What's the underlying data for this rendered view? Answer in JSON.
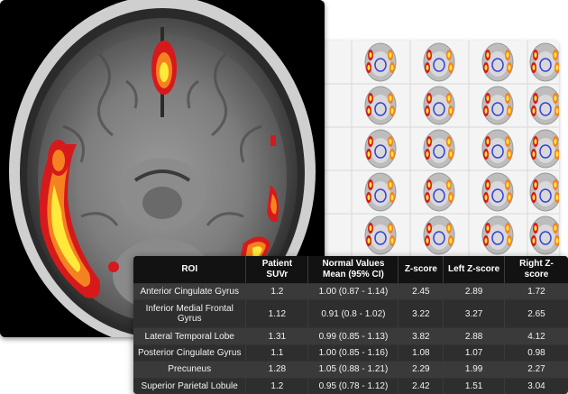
{
  "table": {
    "headers": {
      "roi": "ROI",
      "patient_suvr": "Patient SUVr",
      "normal_values_line1": "Normal Values",
      "normal_values_line2": "Mean (95% CI)",
      "z_score": "Z-score",
      "left_z_score": "Left Z-score",
      "right_z_score": "Right Z-score"
    },
    "rows": [
      {
        "roi": "Anterior Cingulate Gyrus",
        "suvr": "1.2",
        "normal": "1.00 (0.87 - 1.14)",
        "z": "2.45",
        "left_z": "2.89",
        "right_z": "1.72"
      },
      {
        "roi": "Inferior Medial Frontal Gyrus",
        "suvr": "1.12",
        "normal": "0.91 (0.8 - 1.02)",
        "z": "3.22",
        "left_z": "3.27",
        "right_z": "2.65"
      },
      {
        "roi": "Lateral Temporal Lobe",
        "suvr": "1.31",
        "normal": "0.99 (0.85 - 1.13)",
        "z": "3.82",
        "left_z": "2.88",
        "right_z": "4.12"
      },
      {
        "roi": "Posterior Cingulate Gyrus",
        "suvr": "1.1",
        "normal": "1.00 (0.85 - 1.16)",
        "z": "1.08",
        "left_z": "1.07",
        "right_z": "0.98"
      },
      {
        "roi": "Precuneus",
        "suvr": "1.28",
        "normal": "1.05 (0.88 - 1.21)",
        "z": "2.29",
        "left_z": "1.99",
        "right_z": "2.27"
      },
      {
        "roi": "Superior Parietal Lobule",
        "suvr": "1.2",
        "normal": "0.95 (0.78 - 1.12)",
        "z": "2.42",
        "left_z": "1.51",
        "right_z": "3.04"
      }
    ]
  },
  "colors": {
    "hot_low": "#d6191b",
    "hot_mid": "#f58220",
    "hot_high": "#ffe93a",
    "roi_outline": "#3340d6",
    "table_bg": "#1f1f1f"
  },
  "icons": {
    "mri_slice": "axial-brain-mri-with-heatmap",
    "thumbnail_grid": "brain-slice-thumbnail-grid"
  }
}
